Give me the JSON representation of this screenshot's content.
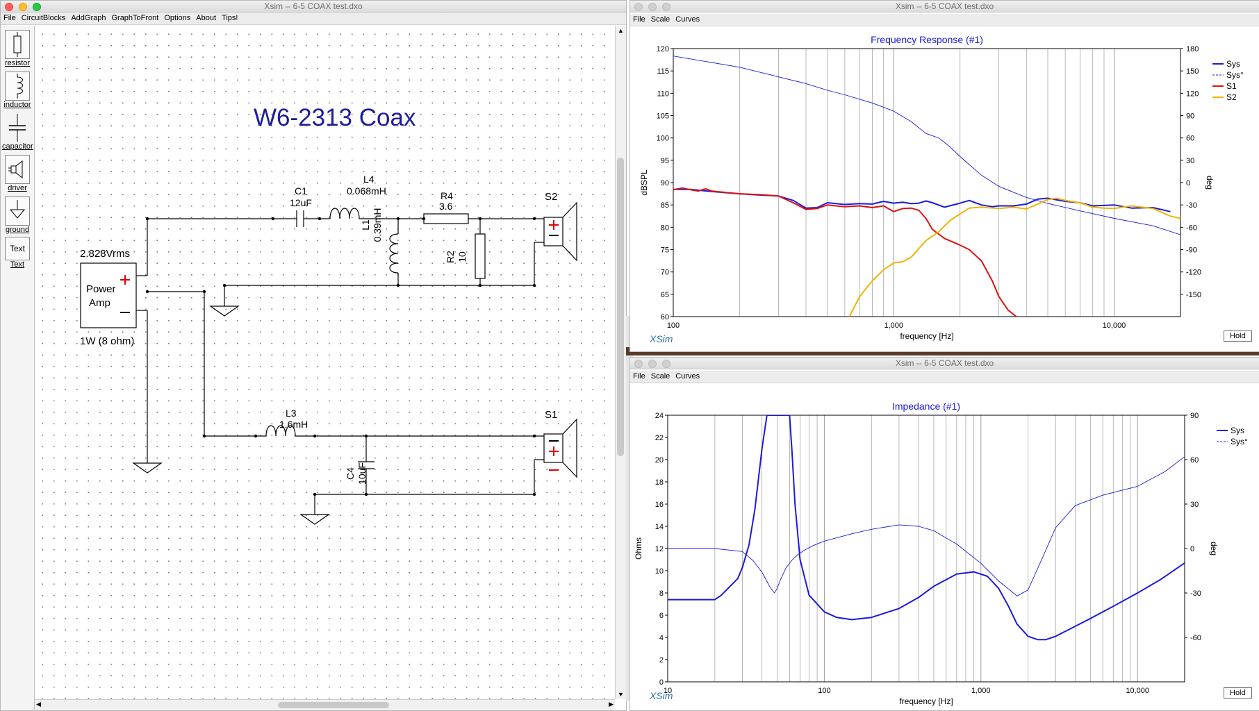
{
  "schematic_window": {
    "title": "Xsim -- 6-5 COAX test.dxo",
    "menu": [
      "File",
      "CircuitBlocks",
      "AddGraph",
      "GraphToFront",
      "Options",
      "About",
      "Tips!"
    ],
    "palette": [
      {
        "label": "resistor",
        "icon": "resistor-icon"
      },
      {
        "label": "inductor",
        "icon": "inductor-icon"
      },
      {
        "label": "capacitor",
        "icon": "capacitor-icon"
      },
      {
        "label": "driver",
        "icon": "driver-icon"
      },
      {
        "label": "ground",
        "icon": "ground-icon"
      },
      {
        "label": "Text",
        "icon": "text-icon",
        "glyph": "Text"
      }
    ],
    "schematic": {
      "title": "W6-2313 Coax",
      "amp_voltage": "2.828Vrms",
      "amp_label_1": "Power",
      "amp_label_2": "Amp",
      "amp_power": "1W (8 ohm)",
      "C1_name": "C1",
      "C1_value": "12uF",
      "L4_name": "L4",
      "L4_value": "0.068mH",
      "R4_name": "R4",
      "R4_value": "3.6",
      "L1_name": "L1",
      "L1_value": "0.39mH",
      "R2_name": "R2",
      "R2_value": "10",
      "S2_name": "S2",
      "L3_name": "L3",
      "L3_value": "1.6mH",
      "C4_name": "C4",
      "C4_value": "10uF",
      "S1_name": "S1"
    }
  },
  "fr_window": {
    "title": "Xsim -- 6-5 COAX test.dxo",
    "menu": [
      "File",
      "Scale",
      "Curves"
    ],
    "hold": "Hold",
    "brand": "XSim"
  },
  "imp_window": {
    "title": "Xsim -- 6-5 COAX test.dxo",
    "menu": [
      "File",
      "Scale",
      "Curves"
    ],
    "hold": "Hold",
    "brand": "XSim"
  },
  "chart_data": [
    {
      "type": "line",
      "title": "Frequency Response (#1)",
      "xlabel": "frequency [Hz]",
      "ylabel": "dBSPL",
      "y2label": "deg",
      "xscale": "log",
      "xlim": [
        100,
        20000
      ],
      "ylim": [
        60,
        120
      ],
      "y2lim": [
        -180,
        180
      ],
      "xticks": [
        "100",
        "1,000",
        "10,000"
      ],
      "yticks": [
        "60",
        "65",
        "70",
        "75",
        "80",
        "85",
        "90",
        "95",
        "100",
        "105",
        "110",
        "115",
        "120"
      ],
      "y2ticks": [
        "-150",
        "-120",
        "-90",
        "-60",
        "-30",
        "0",
        "30",
        "60",
        "90",
        "120",
        "150",
        "180"
      ],
      "legend_position": "top-right",
      "grid": true,
      "series": [
        {
          "name": "Sys",
          "color": "#1a1adf",
          "axis": "left",
          "x": [
            100,
            120,
            150,
            200,
            250,
            300,
            350,
            400,
            450,
            500,
            600,
            700,
            800,
            900,
            1000,
            1100,
            1200,
            1300,
            1400,
            1500,
            1700,
            2000,
            2200,
            2500,
            2800,
            3000,
            3500,
            4000,
            4500,
            5000,
            6000,
            7000,
            8000,
            10000,
            12000,
            15000,
            18000
          ],
          "y": [
            88.5,
            88.5,
            88,
            87.5,
            87.2,
            87,
            86,
            84.3,
            84.4,
            85.5,
            85.1,
            85.3,
            85.2,
            85.8,
            85.4,
            85.6,
            85.3,
            85.4,
            85.9,
            85.5,
            84.5,
            85.4,
            86,
            85,
            84.6,
            84.8,
            84.8,
            85.2,
            86.3,
            86.5,
            85.8,
            85.5,
            84.8,
            85,
            84.3,
            84.4,
            83.5
          ]
        },
        {
          "name": "Sys°",
          "color": "#1a1adf",
          "dashed": true,
          "axis": "right",
          "x": [
            100,
            200,
            300,
            400,
            500,
            600,
            700,
            800,
            1000,
            1200,
            1400,
            1600,
            1800,
            2000,
            2500,
            3000,
            4000,
            5000,
            7000,
            10000,
            15000,
            20000
          ],
          "y": [
            170,
            155,
            142,
            133,
            124,
            118,
            112,
            107,
            96,
            82,
            66,
            60,
            48,
            35,
            10,
            -5,
            -20,
            -28,
            -38,
            -48,
            -58,
            -70
          ]
        },
        {
          "name": "S1",
          "color": "#e01010",
          "axis": "left",
          "x": [
            100,
            110,
            120,
            130,
            140,
            150,
            200,
            250,
            300,
            350,
            400,
            450,
            500,
            600,
            700,
            800,
            900,
            1000,
            1100,
            1200,
            1300,
            1400,
            1500,
            1700,
            2000,
            2200,
            2500,
            2800,
            3000,
            3300,
            3600
          ],
          "y": [
            88.4,
            88.8,
            88.4,
            88.1,
            88.6,
            88.1,
            87.5,
            87.3,
            87,
            85.5,
            84,
            84.2,
            85,
            84.6,
            84.8,
            84.4,
            84.8,
            83.5,
            84.2,
            84.3,
            83.8,
            82,
            79.5,
            77.5,
            76,
            75,
            72.5,
            68,
            64.5,
            61.5,
            60
          ]
        },
        {
          "name": "S2",
          "color": "#f0b400",
          "axis": "left",
          "x": [
            630,
            700,
            800,
            900,
            1000,
            1100,
            1200,
            1400,
            1600,
            1800,
            2000,
            2200,
            2500,
            3000,
            3500,
            4000,
            4500,
            5000,
            5500,
            6000,
            7000,
            8000,
            9000,
            10000,
            12000,
            15000,
            18000,
            20000
          ],
          "y": [
            60,
            64.5,
            68,
            70.5,
            72,
            72.3,
            73.3,
            77,
            79,
            81.5,
            83,
            84.3,
            84.5,
            84.2,
            84.5,
            84.1,
            85.2,
            86.2,
            86.5,
            86,
            85.5,
            84.5,
            84.3,
            84.2,
            84.8,
            84.2,
            82.5,
            82
          ]
        }
      ]
    },
    {
      "type": "line",
      "title": "Impedance (#1)",
      "xlabel": "frequency [Hz]",
      "ylabel": "Ohms",
      "y2label": "deg",
      "xscale": "log",
      "xlim": [
        10,
        20000
      ],
      "ylim": [
        0,
        24
      ],
      "y2lim": [
        -90,
        90
      ],
      "xticks": [
        "10",
        "100",
        "1,000",
        "10,000"
      ],
      "yticks": [
        "0",
        "2",
        "4",
        "6",
        "8",
        "10",
        "12",
        "14",
        "16",
        "18",
        "20",
        "22",
        "24"
      ],
      "y2ticks": [
        "-60",
        "-30",
        "0",
        "30",
        "60",
        "90"
      ],
      "legend_position": "top-right",
      "grid": true,
      "series": [
        {
          "name": "Sys",
          "color": "#1a1adf",
          "axis": "left",
          "x": [
            10,
            15,
            20,
            22,
            25,
            28,
            30,
            33,
            36,
            40,
            43,
            46,
            48,
            50,
            55,
            58,
            60,
            62,
            65,
            70,
            80,
            100,
            120,
            150,
            200,
            300,
            400,
            500,
            700,
            900,
            1100,
            1300,
            1500,
            1700,
            2000,
            2300,
            2600,
            3000,
            4000,
            5000,
            7000,
            10000,
            14000,
            20000
          ],
          "y": [
            7.4,
            7.4,
            7.4,
            7.8,
            8.6,
            9.3,
            10.3,
            12.3,
            15.5,
            21,
            24,
            24,
            24,
            24,
            24,
            24,
            24,
            21,
            16,
            11,
            7.8,
            6.3,
            5.8,
            5.6,
            5.8,
            6.6,
            7.6,
            8.6,
            9.7,
            9.9,
            9.5,
            8.4,
            6.8,
            5.2,
            4.1,
            3.8,
            3.8,
            4.1,
            5,
            5.7,
            6.8,
            8,
            9.2,
            10.7
          ]
        },
        {
          "name": "Sys°",
          "color": "#1a1adf",
          "dashed": true,
          "axis": "right",
          "x": [
            10,
            20,
            30,
            35,
            40,
            45,
            48,
            50,
            53,
            57,
            62,
            68,
            75,
            85,
            100,
            150,
            200,
            300,
            400,
            500,
            700,
            1000,
            1300,
            1700,
            2000,
            2500,
            3000,
            4000,
            6000,
            10000,
            15000,
            20000
          ],
          "y": [
            0,
            0,
            -2,
            -8,
            -16,
            -26,
            -30,
            -27,
            -20,
            -13,
            -8,
            -4,
            -1,
            2,
            5,
            10,
            13,
            16,
            15,
            12,
            3,
            -10,
            -22,
            -32,
            -28,
            -5,
            14,
            29,
            36,
            42,
            52,
            62
          ]
        }
      ]
    }
  ]
}
